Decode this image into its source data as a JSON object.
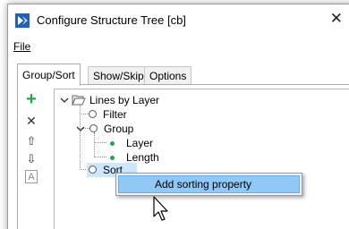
{
  "window": {
    "title": "Configure Structure Tree [cb]",
    "close_glyph": "✕",
    "app_icon": "app-logo-icon"
  },
  "menubar": {
    "file_label": "File"
  },
  "tabs": [
    {
      "label": "Group/Sort",
      "active": true
    },
    {
      "label": "Show/Skip",
      "active": false
    },
    {
      "label": "Options",
      "active": false
    }
  ],
  "toolbar": {
    "add_icon": "plus-icon",
    "remove_icon": "x-icon",
    "move_up_icon": "arrow-up-icon",
    "move_down_icon": "arrow-down-icon",
    "rename_icon": "text-field-icon",
    "add_glyph": "+",
    "remove_glyph": "✕",
    "up_glyph": "⇧",
    "down_glyph": "⇩",
    "rename_glyph": "A"
  },
  "tree": {
    "root": {
      "label": "Lines by Layer",
      "expanded": true
    },
    "filter": {
      "label": "Filter"
    },
    "group": {
      "label": "Group",
      "expanded": true
    },
    "group_children": [
      {
        "label": "Layer"
      },
      {
        "label": "Length"
      }
    ],
    "sort": {
      "label": "Sort",
      "selected": true
    }
  },
  "context_menu": {
    "items": [
      {
        "label": "Add sorting property",
        "highlighted": true
      }
    ]
  },
  "colors": {
    "accent_green": "#1ea84b",
    "selection": "#cce8ff",
    "menu_highlight": "#90c8f6",
    "app_icon_blue": "#1f5fbf"
  }
}
